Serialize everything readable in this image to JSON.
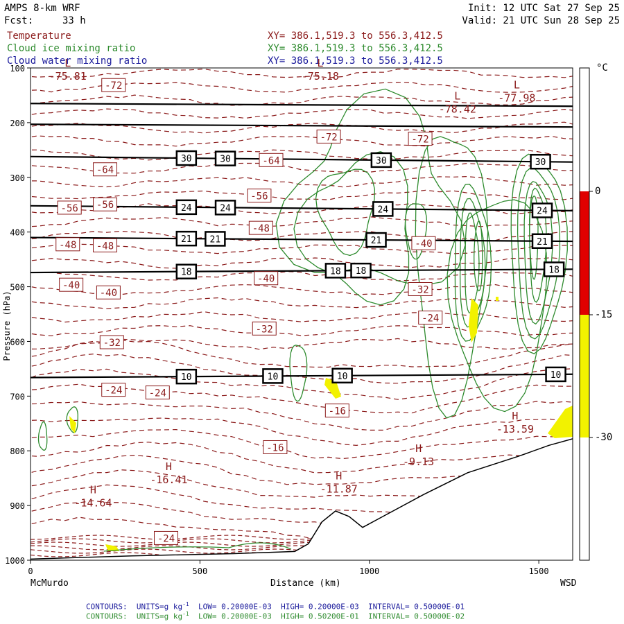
{
  "header": {
    "model": "AMPS 8-km WRF",
    "fcst_label": "Fcst:",
    "fcst_value": "33 h",
    "init": "Init: 12 UTC Sat 27 Sep 25",
    "valid": "Valid: 21 UTC Sun 28 Sep 25"
  },
  "fields": [
    {
      "name": "Temperature",
      "xy": "XY= 386.1,519.3 to 556.3,412.5",
      "color": "#8b1a1a"
    },
    {
      "name": "Cloud ice mixing ratio",
      "xy": "XY= 386.1,519.3 to 556.3,412.5",
      "color": "#2e8b2e"
    },
    {
      "name": "Cloud water mixing ratio",
      "xy": "XY= 386.1,519.3 to 556.3,412.5",
      "color": "#1a1a9b"
    }
  ],
  "colorbar": {
    "unit": "°C",
    "ticks": [
      "0",
      "-15",
      "-30"
    ],
    "colors": {
      "red": "#e00000",
      "yellow": "#f2f200"
    }
  },
  "footer": [
    {
      "text": "CONTOURS:  UNITS=g kg",
      "sup": "-1",
      "rest": "  LOW= 0.20000E-03  HIGH= 0.20000E-03  INTERVAL= 0.50000E-01",
      "color": "#1a1a9b"
    },
    {
      "text": "CONTOURS:  UNITS=g kg",
      "sup": "-1",
      "rest": "  LOW= 0.20000E-03  HIGH= 0.50200E-01  INTERVAL= 0.50000E-02",
      "color": "#2e8b2e"
    }
  ],
  "chart_data": {
    "type": "contour-cross-section",
    "xlabel": "Distance (km)",
    "ylabel": "Pressure (hPa)",
    "xlim": [
      0,
      1600
    ],
    "ylim": [
      1000,
      100
    ],
    "x_ticks": [
      0,
      500,
      1000,
      1500
    ],
    "y_ticks": [
      100,
      200,
      300,
      400,
      500,
      600,
      700,
      800,
      900,
      1000
    ],
    "start_label": "McMurdo",
    "end_label": "WSD",
    "isotach_lines": [
      {
        "p0": 165,
        "p1": 170
      },
      {
        "p0": 203,
        "p1": 208
      },
      {
        "p0": 262,
        "p1": 272
      },
      {
        "p0": 352,
        "p1": 361,
        "label": "24",
        "label_x": [
          460,
          575,
          1040,
          1510
        ]
      },
      {
        "p0": 410,
        "p1": 417,
        "label": "21",
        "label_x": [
          460,
          545,
          1020,
          1510
        ]
      },
      {
        "p0": 474,
        "p1": 468,
        "label": "18",
        "label_x": [
          460,
          900,
          975,
          1545
        ]
      },
      {
        "p0": 666,
        "p1": 660,
        "label": "10",
        "label_x": [
          460,
          715,
          920,
          1550
        ]
      }
    ],
    "isotach_30": {
      "label": "30",
      "label_x": [
        460,
        575,
        1035,
        1505
      ]
    },
    "temperature_labels": [
      {
        "text": "-72",
        "x": 245,
        "p": 132
      },
      {
        "text": "-72",
        "x": 880,
        "p": 226
      },
      {
        "text": "-72",
        "x": 1150,
        "p": 230
      },
      {
        "text": "-64",
        "x": 220,
        "p": 286
      },
      {
        "text": "-64",
        "x": 710,
        "p": 269
      },
      {
        "text": "-56",
        "x": 115,
        "p": 356
      },
      {
        "text": "-56",
        "x": 220,
        "p": 350
      },
      {
        "text": "-56",
        "x": 675,
        "p": 334
      },
      {
        "text": "-48",
        "x": 110,
        "p": 423
      },
      {
        "text": "-48",
        "x": 220,
        "p": 425
      },
      {
        "text": "-48",
        "x": 680,
        "p": 393
      },
      {
        "text": "-40",
        "x": 120,
        "p": 497
      },
      {
        "text": "-40",
        "x": 230,
        "p": 511
      },
      {
        "text": "-40",
        "x": 695,
        "p": 485
      },
      {
        "text": "-40",
        "x": 1160,
        "p": 421
      },
      {
        "text": "-32",
        "x": 240,
        "p": 602
      },
      {
        "text": "-32",
        "x": 690,
        "p": 577
      },
      {
        "text": "-32",
        "x": 1150,
        "p": 505
      },
      {
        "text": "-24",
        "x": 245,
        "p": 689
      },
      {
        "text": "-24",
        "x": 375,
        "p": 694
      },
      {
        "text": "-24",
        "x": 1180,
        "p": 557
      },
      {
        "text": "-24",
        "x": 400,
        "p": 960
      },
      {
        "text": "-16",
        "x": 905,
        "p": 727
      },
      {
        "text": "-16",
        "x": 722,
        "p": 794
      }
    ],
    "extrema": [
      {
        "kind": "L",
        "value": "-75.81",
        "x": 110,
        "p": 100
      },
      {
        "kind": "L",
        "value": "-75.18",
        "x": 855,
        "p": 100
      },
      {
        "kind": "L",
        "value": "-78.42",
        "x": 1260,
        "p": 160
      },
      {
        "kind": "L",
        "value": "-77.98",
        "x": 1435,
        "p": 140
      },
      {
        "kind": "H",
        "value": "-14.64",
        "x": 185,
        "p": 880
      },
      {
        "kind": "H",
        "value": "-16.41",
        "x": 408,
        "p": 838
      },
      {
        "kind": "H",
        "value": "-11.87",
        "x": 910,
        "p": 855
      },
      {
        "kind": "H",
        "value": "-9.13",
        "x": 1145,
        "p": 805
      },
      {
        "kind": "H",
        "value": "-13.59",
        "x": 1430,
        "p": 745
      }
    ],
    "terrain_surface_p": [
      [
        0,
        998
      ],
      [
        100,
        996
      ],
      [
        300,
        992
      ],
      [
        600,
        988
      ],
      [
        780,
        984
      ],
      [
        820,
        970
      ],
      [
        860,
        930
      ],
      [
        900,
        910
      ],
      [
        940,
        920
      ],
      [
        980,
        940
      ],
      [
        1040,
        920
      ],
      [
        1160,
        880
      ],
      [
        1290,
        840
      ],
      [
        1440,
        810
      ],
      [
        1530,
        790
      ],
      [
        1600,
        778
      ]
    ]
  }
}
